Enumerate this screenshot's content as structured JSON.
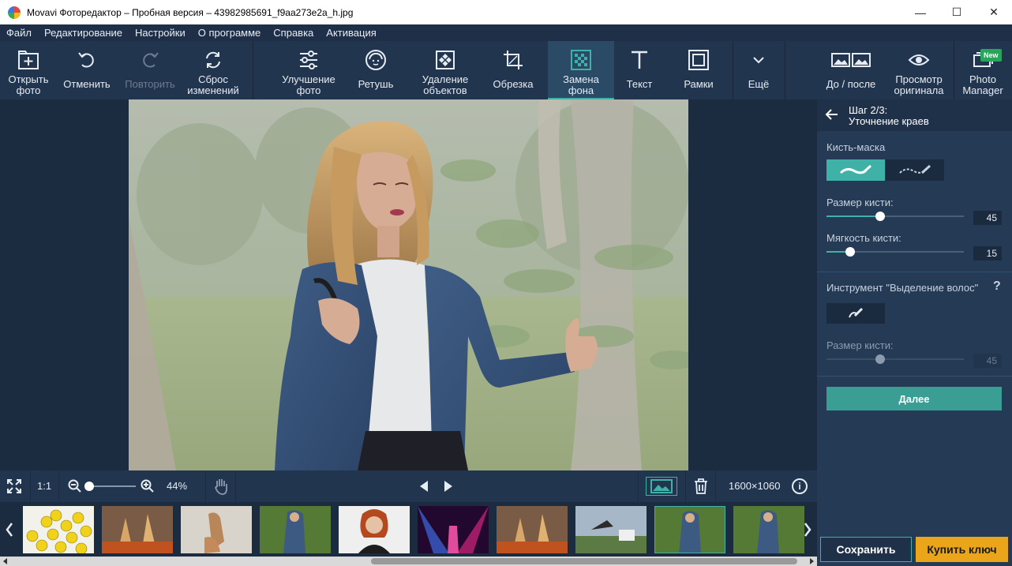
{
  "window": {
    "title": "Movavi Фоторедактор – Пробная версия – 43982985691_f9aa273e2a_h.jpg",
    "minimize": "—",
    "maximize": "☐",
    "close": "✕"
  },
  "menu": [
    "Файл",
    "Редактирование",
    "Настройки",
    "О программе",
    "Справка",
    "Активация"
  ],
  "toolbar": {
    "open": [
      "Открыть",
      "фото"
    ],
    "undo": "Отменить",
    "redo": "Повторить",
    "reset": [
      "Сброс",
      "изменений"
    ],
    "enhance": [
      "Улучшение",
      "фото"
    ],
    "retouch": "Ретушь",
    "remove_objects": [
      "Удаление",
      "объектов"
    ],
    "crop": "Обрезка",
    "replace_bg": [
      "Замена",
      "фона"
    ],
    "text": "Текст",
    "frames": "Рамки",
    "more": "Ещё",
    "before_after": "До / после",
    "view_original": [
      "Просмотр",
      "оригинала"
    ],
    "photo_manager": [
      "Photo",
      "Manager"
    ],
    "new_badge": "New"
  },
  "panel": {
    "step": "Шаг 2/3:",
    "step_title": "Уточнение краев",
    "brush_mask_label": "Кисть-маска",
    "brush_size_label": "Размер кисти:",
    "brush_size_value": "45",
    "brush_size_level": 0.39,
    "softness_label": "Мягкость кисти:",
    "softness_value": "15",
    "softness_level": 0.17,
    "hair_tool_label": "Инструмент \"Выделение волос\"",
    "help": "?",
    "hair_size_label": "Размер кисти:",
    "hair_size_value": "45",
    "hair_size_level": 0.39,
    "next_button": "Далее"
  },
  "bottom": {
    "zoom_fit": "1:1",
    "zoom_percent": "44%",
    "zoom_level": 0.05,
    "dimensions": "1600×1060",
    "info": "i"
  },
  "actions": {
    "save": "Сохранить",
    "buy": "Купить ключ"
  },
  "colors": {
    "accent": "#3fb1a7",
    "buy": "#eaa51a",
    "bg": "#1b2b40"
  }
}
